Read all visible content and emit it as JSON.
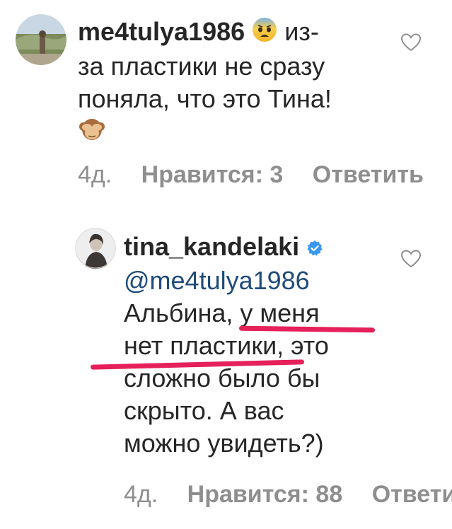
{
  "comments": [
    {
      "username": "me4tulya1986",
      "text_line1": "из-",
      "text_line2": "за пластики не сразу",
      "text_line3": "поняла, что  это Тина!",
      "emoji_inline": "fearful-face",
      "emoji_end": "see-no-evil-monkey",
      "time": "4д.",
      "likes": "Нравится: 3",
      "reply": "Ответить"
    },
    {
      "username": "tina_kandelaki",
      "verified": true,
      "mention": "@me4tulya1986",
      "line1": "Альбина, у меня",
      "line2": "нет пластики, это",
      "line3": "сложно было бы",
      "line4": "скрыто. А вас",
      "line5": "можно увидеть?)",
      "time": "4д.",
      "likes": "Нравится: 88",
      "reply": "Ответить"
    }
  ],
  "colors": {
    "verified": "#3897f0",
    "annotation": "#e5205a",
    "mention": "#1f4b7a",
    "meta": "#8e8e8e"
  }
}
